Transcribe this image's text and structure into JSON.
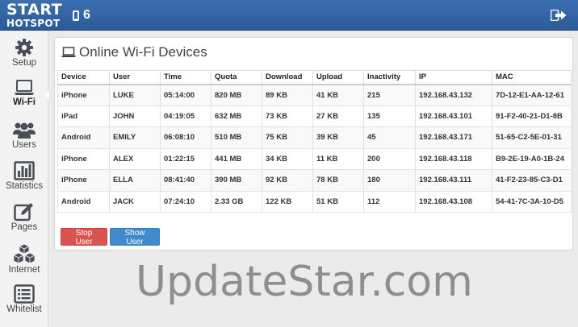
{
  "header": {
    "logo_top": "START",
    "logo_bottom": "HOTSPOT",
    "device_count": "6",
    "logout_icon": "logout-icon"
  },
  "sidebar": {
    "items": [
      {
        "label": "Setup",
        "icon": "gear-icon"
      },
      {
        "label": "Wi-Fi",
        "icon": "laptop-icon",
        "active": true
      },
      {
        "label": "Users",
        "icon": "users-icon"
      },
      {
        "label": "Statistics",
        "icon": "bar-chart-icon"
      },
      {
        "label": "Pages",
        "icon": "edit-icon"
      },
      {
        "label": "Internet",
        "icon": "cubes-icon"
      },
      {
        "label": "Whitelist",
        "icon": "list-icon"
      }
    ]
  },
  "panel": {
    "title": "Online Wi-Fi Devices",
    "columns": [
      "Device",
      "User",
      "Time",
      "Quota",
      "Download",
      "Upload",
      "Inactivity",
      "IP",
      "MAC"
    ],
    "rows": [
      [
        "iPhone",
        "LUKE",
        "05:14:00",
        "820 MB",
        "89 KB",
        "41 KB",
        "215",
        "192.168.43.132",
        "7D-12-E1-AA-12-61"
      ],
      [
        "iPad",
        "JOHN",
        "04:19:05",
        "632 MB",
        "73 KB",
        "27 KB",
        "135",
        "192.168.43.101",
        "91-F2-40-21-D1-8B"
      ],
      [
        "Android",
        "EMILY",
        "06:08:10",
        "510 MB",
        "75 KB",
        "39 KB",
        "45",
        "192.168.43.171",
        "51-65-C2-5E-01-31"
      ],
      [
        "iPhone",
        "ALEX",
        "01:22:15",
        "441 MB",
        "34 KB",
        "11 KB",
        "200",
        "192.168.43.118",
        "B9-2E-19-A0-1B-24"
      ],
      [
        "iPhone",
        "ELLA",
        "08:41:40",
        "390 MB",
        "92 KB",
        "78 KB",
        "180",
        "192.168.43.111",
        "41-F2-23-85-C3-D1"
      ],
      [
        "Android",
        "JACK",
        "07:24:10",
        "2.33 GB",
        "122 KB",
        "51 KB",
        "112",
        "192.168.43.108",
        "54-41-7C-3A-10-D5"
      ]
    ],
    "stop_button": "Stop User",
    "show_button": "Show User"
  },
  "watermark": "UpdateStar.com",
  "colors": {
    "header": "#2c5a97",
    "stop": "#d9534f",
    "show": "#428bca",
    "icon": "#4a4f55"
  }
}
